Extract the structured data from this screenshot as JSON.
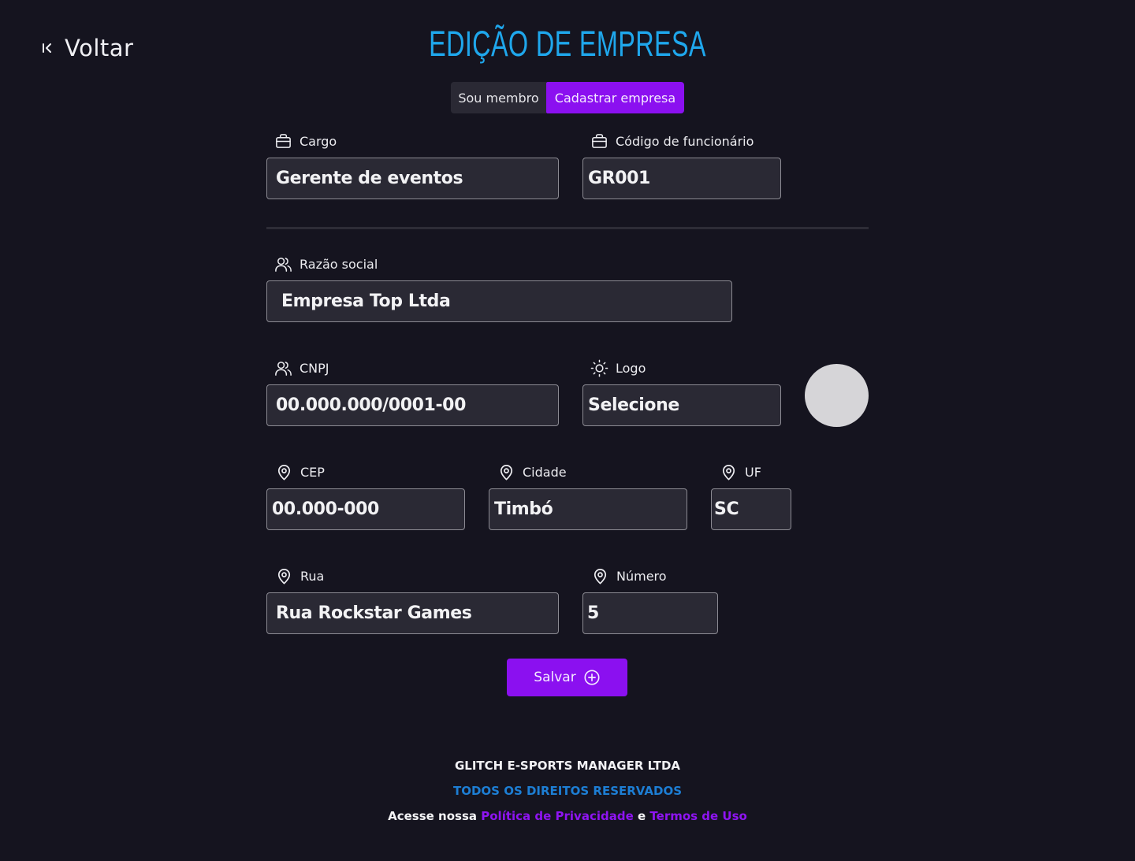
{
  "nav": {
    "back_label": "Voltar"
  },
  "header": {
    "title": "EDIÇÃO DE EMPRESA"
  },
  "tabs": [
    {
      "label": "Sou membro",
      "active": false
    },
    {
      "label": "Cadastrar empresa",
      "active": true
    }
  ],
  "form": {
    "cargo": {
      "label": "Cargo",
      "value": "Gerente de eventos",
      "icon": "briefcase-icon"
    },
    "codigo": {
      "label": "Código de funcionário",
      "value": "GR001",
      "icon": "briefcase-icon"
    },
    "razao_social": {
      "label": "Razão social",
      "value": "Empresa Top Ltda",
      "icon": "users-icon"
    },
    "cnpj": {
      "label": "CNPJ",
      "value": "00.000.000/0001-00",
      "icon": "users-icon"
    },
    "logo": {
      "label": "Logo",
      "value": "Selecione",
      "icon": "sun-icon"
    },
    "cep": {
      "label": "CEP",
      "value": "00.000-000",
      "icon": "map-pin-icon"
    },
    "cidade": {
      "label": "Cidade",
      "value": "Timbó",
      "icon": "map-pin-icon"
    },
    "uf": {
      "label": "UF",
      "value": "SC",
      "icon": "map-pin-icon"
    },
    "rua": {
      "label": "Rua",
      "value": "Rua Rockstar Games",
      "icon": "map-pin-icon"
    },
    "numero": {
      "label": "Número",
      "value": "5",
      "icon": "map-pin-icon"
    }
  },
  "actions": {
    "save_label": "Salvar"
  },
  "footer": {
    "company": "GLITCH E-SPORTS MANAGER LTDA",
    "rights": "TODOS OS DIREITOS RESERVADOS",
    "access_prefix": "Acesse nossa",
    "privacy_link": "Política de Privacidade",
    "conjunction": "e",
    "terms_link": "Termos de Uso"
  },
  "colors": {
    "background": "#15141f",
    "accent_purple": "#8b10f0",
    "title_blue": "#1fa7ec",
    "rights_blue": "#1d7ed4",
    "field_bg": "#2a2934"
  }
}
